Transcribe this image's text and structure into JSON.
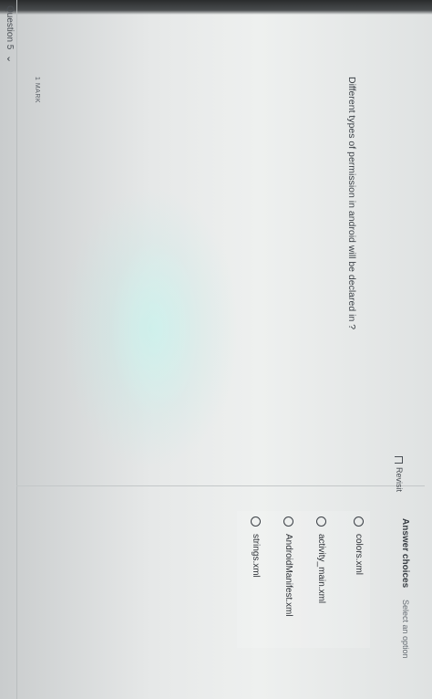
{
  "header": {
    "question_label": "Question 5",
    "chevron_icon": "chevron-down-icon",
    "marks_label": "1 MARK"
  },
  "question": {
    "text": "Different types of permission in android will be declared in ?"
  },
  "revisit": {
    "label": "Revisit",
    "icon": "bookmark-icon"
  },
  "answers": {
    "title": "Answer choices",
    "hint": "Select an option",
    "options": [
      {
        "label": "colors.xml"
      },
      {
        "label": "activity_main.xml"
      },
      {
        "label": "AndroidManifest.xml"
      },
      {
        "label": "strings.xml"
      }
    ]
  },
  "colors": {
    "text": "#3a3f45",
    "divider": "#b9bdbe"
  }
}
